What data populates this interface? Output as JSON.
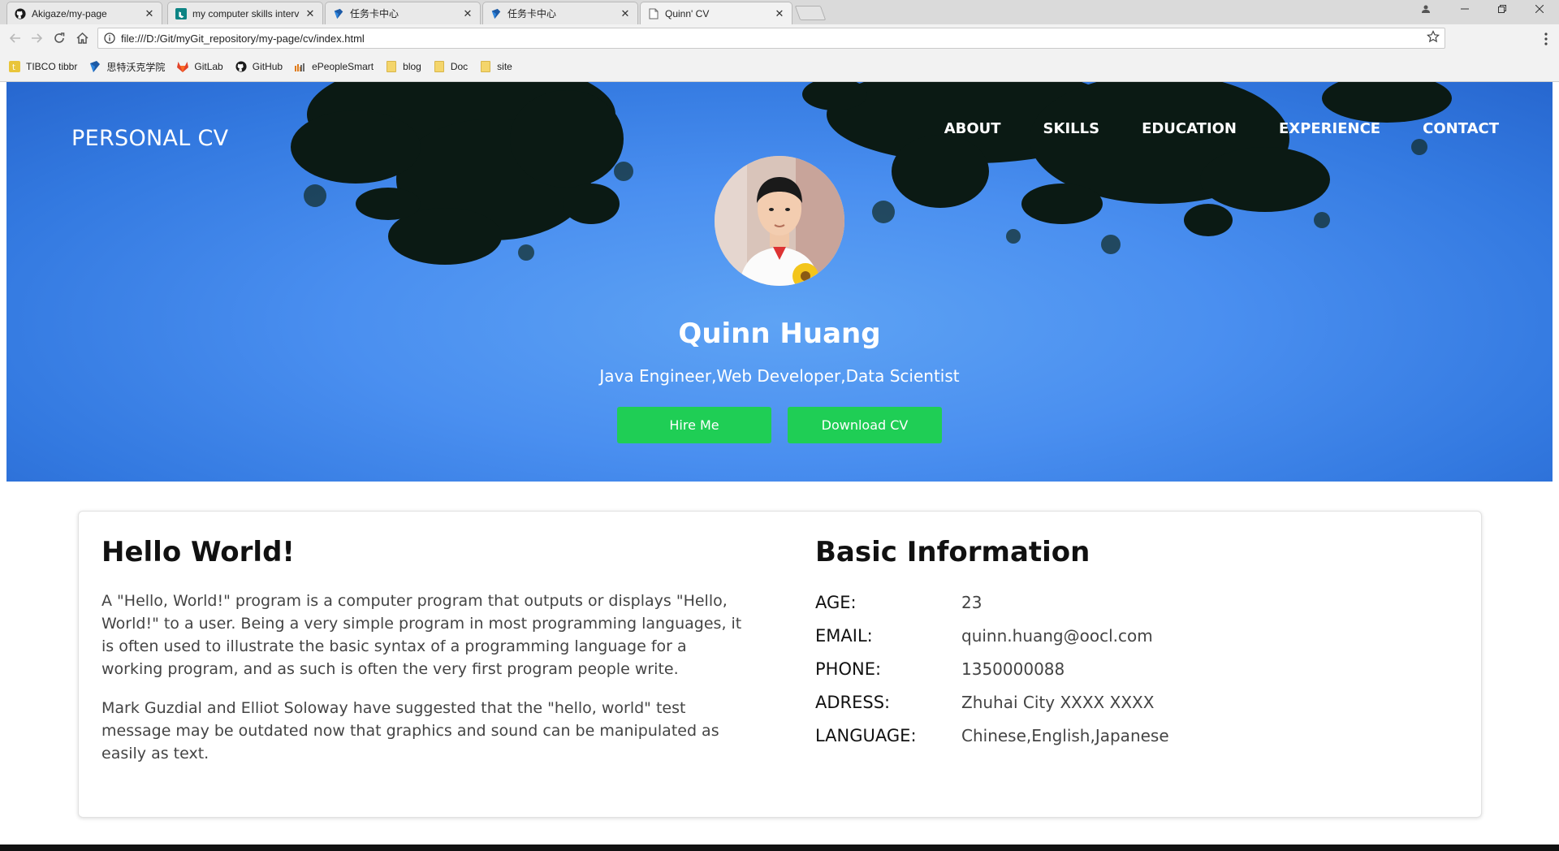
{
  "browser": {
    "tabs": [
      {
        "title": "Akigaze/my-page",
        "icon": "github-icon"
      },
      {
        "title": "my computer skills interv",
        "icon": "bing-icon"
      },
      {
        "title": "任务卡中心",
        "icon": "task-icon"
      },
      {
        "title": "任务卡中心",
        "icon": "task-icon"
      },
      {
        "title": "Quinn' CV",
        "icon": "page-icon"
      }
    ],
    "close_glyph": "✕",
    "url": "file:///D:/Git/myGit_repository/my-page/cv/index.html",
    "bookmarks": [
      {
        "label": "TIBCO tibbr",
        "icon": "tibbr-icon"
      },
      {
        "label": "思特沃克学院",
        "icon": "thoughtworks-icon"
      },
      {
        "label": "GitLab",
        "icon": "gitlab-icon"
      },
      {
        "label": "GitHub",
        "icon": "github-icon"
      },
      {
        "label": "ePeopleSmart",
        "icon": "epeoplesmart-icon"
      },
      {
        "label": "blog",
        "icon": "folder-icon"
      },
      {
        "label": "Doc",
        "icon": "folder-icon"
      },
      {
        "label": "site",
        "icon": "folder-icon"
      }
    ]
  },
  "hero": {
    "brand": "PERSONAL CV",
    "nav": [
      "ABOUT",
      "SKILLS",
      "EDUCATION",
      "EXPERIENCE",
      "CONTACT"
    ],
    "name": "Quinn Huang",
    "subtitle": "Java Engineer,Web Developer,Data Scientist",
    "hire_label": "Hire Me",
    "download_label": "Download CV",
    "accent_color": "#1fce55",
    "sky_color": "#4a8ff0"
  },
  "about": {
    "heading": "Hello World!",
    "paragraphs": [
      "A \"Hello, World!\" program is a computer program that outputs or displays \"Hello, World!\" to a user. Being a very simple program in most programming languages, it is often used to illustrate the basic syntax of a programming language for a working program, and as such is often the very first program people write.",
      "Mark Guzdial and Elliot Soloway have suggested that the \"hello, world\" test message may be outdated now that graphics and sound can be manipulated as easily as text."
    ]
  },
  "basic_info": {
    "heading": "Basic Information",
    "rows": [
      {
        "key": "AGE:",
        "value": "23"
      },
      {
        "key": "EMAIL:",
        "value": "quinn.huang@oocl.com"
      },
      {
        "key": "PHONE:",
        "value": "1350000088"
      },
      {
        "key": "ADRESS:",
        "value": "Zhuhai City XXXX XXXX"
      },
      {
        "key": "LANGUAGE:",
        "value": "Chinese,English,Japanese"
      }
    ]
  }
}
